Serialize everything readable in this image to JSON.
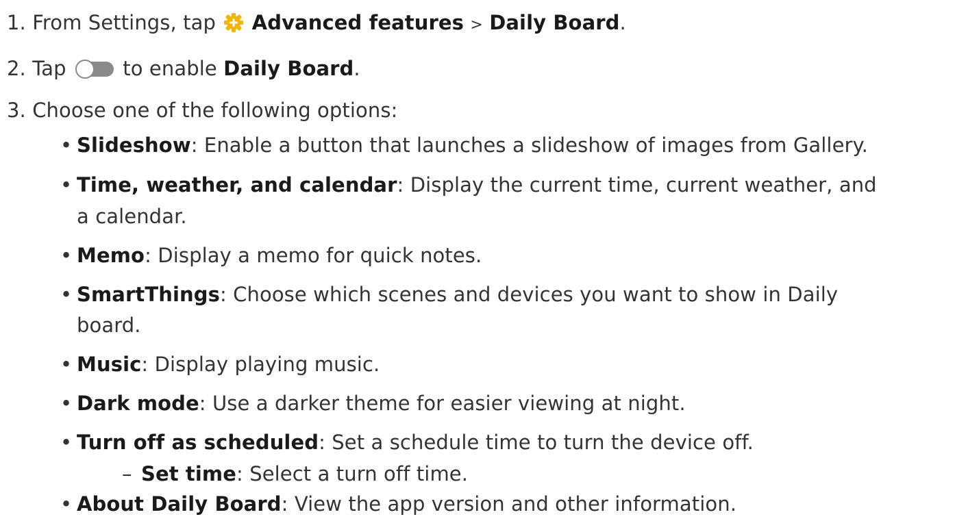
{
  "steps": [
    {
      "number": "1.",
      "text_before": "From Settings, tap",
      "icon": "gear-icon",
      "bold_1": "Advanced features",
      "separator": ">",
      "bold_2": "Daily Board",
      "text_after": "."
    },
    {
      "number": "2.",
      "text_before": "Tap",
      "icon": "toggle-switch-icon",
      "text_middle": "to enable",
      "bold_1": "Daily Board",
      "text_after": "."
    },
    {
      "number": "3.",
      "text": "Choose one of the following options:"
    }
  ],
  "options": [
    {
      "label": "Slideshow",
      "desc": ": Enable a button that launches a slideshow of images from Gallery."
    },
    {
      "label": "Time, weather, and calendar",
      "desc": ": Display the current time, current weather, and",
      "desc_cont": "a calendar."
    },
    {
      "label": "Memo",
      "desc": ": Display a memo for quick notes."
    },
    {
      "label": "SmartThings",
      "desc": ": Choose which scenes and devices you want to show in Daily",
      "desc_cont": "board."
    },
    {
      "label": "Music",
      "desc": ": Display playing music."
    },
    {
      "label": "Dark mode",
      "desc": ": Use a darker theme for easier viewing at night."
    },
    {
      "label": "Turn off as scheduled",
      "desc": ": Set a schedule time to turn the device off."
    },
    {
      "label": "About Daily Board",
      "desc": ": View the app version and other information."
    }
  ],
  "sub_option": {
    "label": "Set time",
    "desc": ": Select a turn off time."
  },
  "colors": {
    "gear_icon": "#f4b400",
    "toggle_knob": "#ffffff",
    "toggle_track": "#8a8a8a"
  }
}
